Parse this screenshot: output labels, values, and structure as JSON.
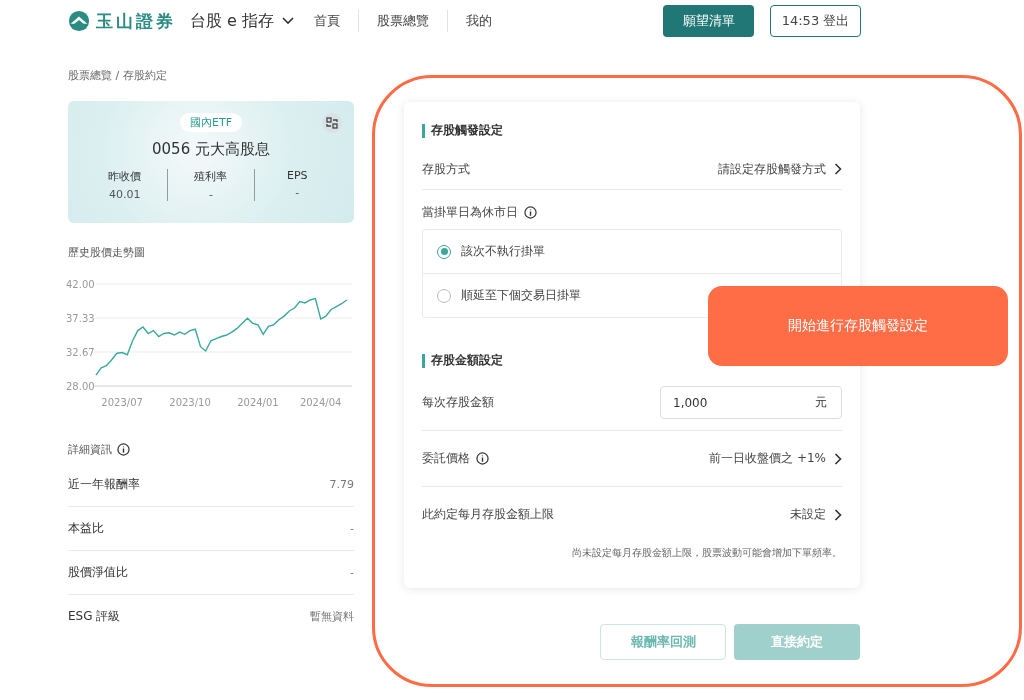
{
  "header": {
    "brand": "玉山證券",
    "product": "台股 e 指存",
    "nav": [
      {
        "label": "首頁"
      },
      {
        "label": "股票總覽"
      },
      {
        "label": "我的"
      }
    ],
    "wishlist_button": "願望清單",
    "logout_button": "14:53 登出"
  },
  "breadcrumb": "股票總覽 / 存股約定",
  "stock_card": {
    "tag": "國內ETF",
    "name": "0056 元大高股息",
    "stats": [
      {
        "label": "昨收價",
        "value": "40.01"
      },
      {
        "label": "殖利率",
        "value": "-"
      },
      {
        "label": "EPS",
        "value": "-"
      }
    ]
  },
  "chart_title": "歷史股價走勢圖",
  "chart_data": {
    "type": "line",
    "categories": [
      null,
      null,
      null,
      null,
      null,
      "2023/07",
      null,
      null,
      null,
      null,
      null,
      null,
      null,
      null,
      null,
      null,
      null,
      null,
      "2023/10",
      null,
      null,
      null,
      null,
      null,
      null,
      null,
      null,
      null,
      null,
      null,
      null,
      "2024/01",
      null,
      null,
      null,
      null,
      null,
      null,
      null,
      null,
      null,
      null,
      null,
      "2024/04",
      null,
      null,
      null,
      null,
      null
    ],
    "ylim": [
      28,
      42
    ],
    "yticks": [
      {
        "value": 28,
        "label": "28.00"
      },
      {
        "value": 32.67,
        "label": "32.67"
      },
      {
        "value": 37.33,
        "label": "37.33"
      },
      {
        "value": 42,
        "label": "42.00"
      }
    ],
    "series": [
      {
        "color": "#3aa99b",
        "values": [
          29.5,
          30.5,
          30.8,
          31.6,
          32.5,
          32.6,
          32.3,
          34.2,
          35.6,
          36.1,
          35.2,
          35.6,
          34.8,
          35.2,
          35.3,
          35.0,
          35.4,
          35.1,
          35.6,
          35.8,
          33.4,
          32.8,
          34.2,
          34.5,
          34.8,
          35.0,
          35.4,
          35.9,
          36.6,
          37.3,
          36.6,
          36.4,
          35.1,
          36.2,
          36.4,
          37.1,
          37.6,
          38.3,
          38.7,
          39.6,
          39.4,
          39.8,
          40.0,
          37.2,
          37.6,
          38.5,
          38.9,
          39.3,
          39.8
        ]
      }
    ]
  },
  "details": {
    "title": "詳細資訊",
    "rows": [
      {
        "label": "近一年報酬率",
        "value": "7.79"
      },
      {
        "label": "本益比",
        "value": "-"
      },
      {
        "label": "股價淨值比",
        "value": "-"
      },
      {
        "label": "ESG 評級",
        "value": "暫無資料"
      }
    ]
  },
  "trigger_section": {
    "title": "存股觸發設定",
    "method": {
      "label": "存股方式",
      "value": "請設定存股觸發方式"
    },
    "holiday": {
      "label": "當掛單日為休市日",
      "options": [
        {
          "label": "該次不執行掛單",
          "selected": true
        },
        {
          "label": "順延至下個交易日掛單",
          "selected": false
        }
      ]
    }
  },
  "amount_section": {
    "title": "存股金額設定",
    "amount": {
      "label": "每次存股金額",
      "value": "1,000",
      "unit": "元"
    },
    "price": {
      "label": "委託價格",
      "value": "前一日收盤價之 +1%"
    },
    "monthly_limit": {
      "label": "此約定每月存股金額上限",
      "value": "未設定"
    },
    "note": "尚未設定每月存股金額上限，股票波動可能會增加下單頻率。"
  },
  "buttons": [
    {
      "label": "報酬率回測",
      "disabled": false
    },
    {
      "label": "直接約定",
      "disabled": true
    }
  ],
  "callout": "開始進行存股觸發設定"
}
